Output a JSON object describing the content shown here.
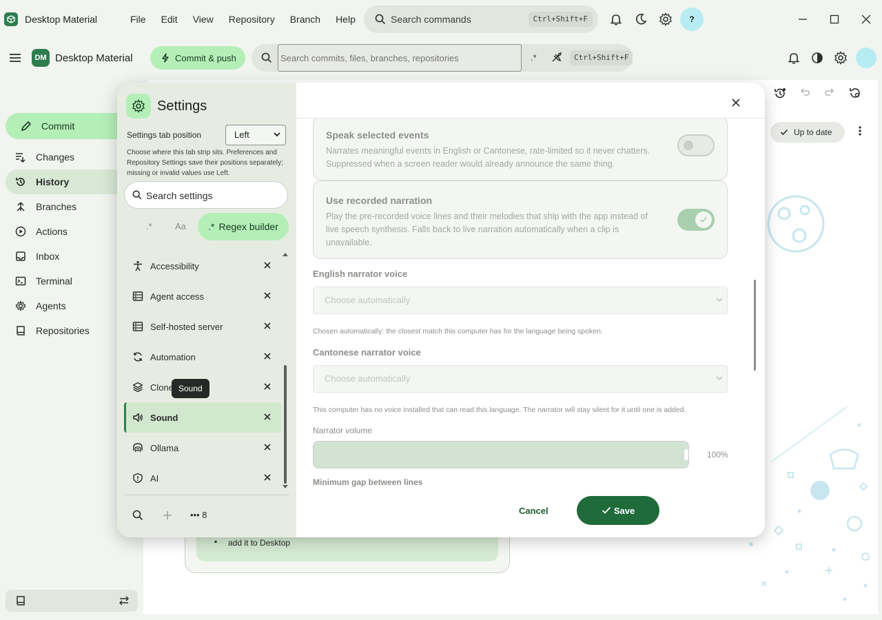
{
  "app": {
    "title": "Desktop Material",
    "badge": "DM"
  },
  "menu": [
    "File",
    "Edit",
    "View",
    "Repository",
    "Branch",
    "Help"
  ],
  "command_search": {
    "placeholder": "Search commands",
    "shortcut": "Ctrl+Shift+F"
  },
  "help_label": "?",
  "toolbar": {
    "commit_push": "Commit & push",
    "search_placeholder": "Search commits, files, branches, repositories",
    "regex_symbol": ".*",
    "shortcut": "Ctrl+Shift+F"
  },
  "nav": {
    "commit": "Commit",
    "items": [
      {
        "label": "Changes",
        "icon": "changes-icon",
        "active": false
      },
      {
        "label": "History",
        "icon": "history-icon",
        "active": true
      },
      {
        "label": "Branches",
        "icon": "branches-icon",
        "active": false
      },
      {
        "label": "Actions",
        "icon": "actions-icon",
        "active": false
      },
      {
        "label": "Inbox",
        "icon": "inbox-icon",
        "active": false
      },
      {
        "label": "Terminal",
        "icon": "terminal-icon",
        "active": false
      },
      {
        "label": "Agents",
        "icon": "agents-icon",
        "active": false
      },
      {
        "label": "Repositories",
        "icon": "repositories-icon",
        "active": false
      }
    ]
  },
  "background": {
    "status": "Up to date",
    "card_text": "add it to Desktop"
  },
  "settings": {
    "title": "Settings",
    "tab_position_label": "Settings tab position",
    "tab_position_value": "Left",
    "tab_position_help": "Choose where this tab strip sits. Preferences and Repository Settings save their positions separately; missing or invalid values use Left.",
    "search_placeholder": "Search settings",
    "regex_option": ".*",
    "case_option": "Aa",
    "regex_builder": "Regex builder",
    "tooltip": "Sound",
    "more_count": "8",
    "categories": [
      {
        "label": "Accessibility",
        "icon": "accessibility-icon",
        "active": false
      },
      {
        "label": "Agent access",
        "icon": "server-icon",
        "active": false
      },
      {
        "label": "Self-hosted server",
        "icon": "server-icon",
        "active": false
      },
      {
        "label": "Automation",
        "icon": "sync-icon",
        "active": false
      },
      {
        "label": "Clone",
        "icon": "layers-icon",
        "active": false
      },
      {
        "label": "Sound",
        "icon": "speaker-icon",
        "active": true
      },
      {
        "label": "Ollama",
        "icon": "ollama-icon",
        "active": false
      },
      {
        "label": "AI",
        "icon": "shield-icon",
        "active": false
      }
    ],
    "speak_events": {
      "title": "Speak selected events",
      "description": "Narrates meaningful events in English or Cantonese, rate-limited so it never chatters. Suppressed when a screen reader would already announce the same thing.",
      "enabled": false
    },
    "recorded_narration": {
      "title": "Use recorded narration",
      "description": "Play the pre-recorded voice lines and their melodies that ship with the app instead of live speech synthesis. Falls back to live narration automatically when a clip is unavailable.",
      "enabled": true
    },
    "english_voice": {
      "label": "English narrator voice",
      "value": "Choose automatically",
      "help": "Chosen automatically: the closest match this computer has for the language being spoken."
    },
    "cantonese_voice": {
      "label": "Cantonese narrator voice",
      "value": "Choose automatically",
      "help": "This computer has no voice installed that can read this language. The narrator will stay silent for it until one is added."
    },
    "volume": {
      "label": "Narrator volume",
      "value_text": "100%",
      "value": 1.0
    },
    "min_gap_label": "Minimum gap between lines",
    "cancel": "Cancel",
    "save": "Save"
  }
}
